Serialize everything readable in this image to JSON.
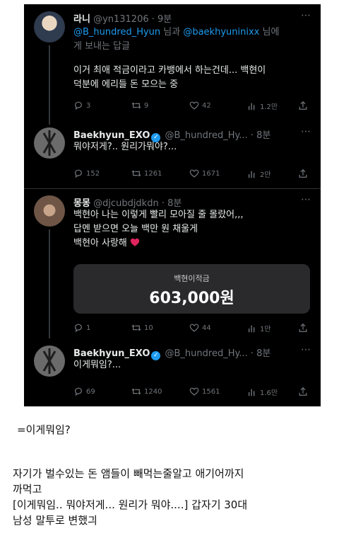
{
  "tweets": [
    {
      "name": "라니",
      "handle": "@yn131206 · 9분",
      "reply_prefix": "@B_hundred_Hyun",
      "reply_mid": " 님과 ",
      "reply_user2": "@baekhyuninixx",
      "reply_tail": " 님에",
      "reply_line2": "게 보내는 답글",
      "text1": "이거 최애 적금이라고 카뱅에서 하는건데... 백현이",
      "text2": "덕분에 에리들 돈 모으는 중",
      "replies": "3",
      "retweets": "9",
      "likes": "42",
      "views": "1.2만"
    },
    {
      "name": "Baekhyun_EXO",
      "handle": "@B_hundred_Hy... · 8분",
      "text1": "뭐야저게?.. 원리가뭐야?...",
      "replies": "152",
      "retweets": "1261",
      "likes": "1671",
      "views": "2만"
    },
    {
      "name": "몽몽",
      "handle": "@djcubdjdkdn · 8분",
      "text1": "백현아 나는 이렇게 빨리 모아질 줄 몰랐어,,,",
      "text2": "답멘 받으면 오늘 백만 원 채울게",
      "text3": "백현아 사랑해",
      "card_label": "백현이적금",
      "card_amount": "603,000원",
      "replies": "1",
      "retweets": "10",
      "likes": "44",
      "views": "1만"
    },
    {
      "name": "Baekhyun_EXO",
      "handle": "@B_hundred_Hy... · 8분",
      "text1": "이게뭐임?...",
      "replies": "69",
      "retweets": "1240",
      "likes": "1561",
      "views": "1.6만"
    }
  ],
  "caption": "=이게뭐임?",
  "paragraph": [
    "자기가 벌수있는 돈 앰들이 빼먹는줄알고 애기어까지",
    "까먹고",
    "[이게뭐임.. 뭐야저게... 원리가 뭐야....] 갑자기 30대",
    "남성 말투로 변했긔"
  ],
  "icons": [
    "reply-icon",
    "retweet-icon",
    "like-icon",
    "views-icon",
    "share-icon",
    "verified-badge-icon",
    "more-icon",
    "heart-emoji-icon"
  ],
  "colors": {
    "background": "#000000",
    "link": "#1d9bf0",
    "muted": "#71767b",
    "heart": "#e0245e"
  }
}
